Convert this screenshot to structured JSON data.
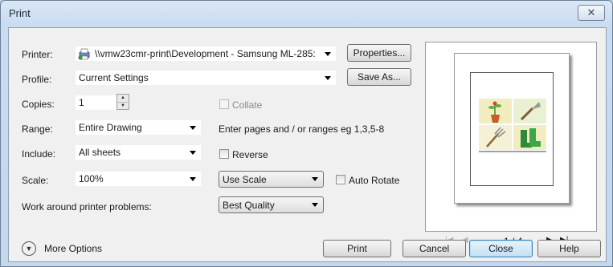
{
  "window": {
    "title": "Print",
    "close_label": "✕"
  },
  "printer": {
    "label": "Printer:",
    "value": "\\\\vmw23cmr-print\\Development - Samsung ML-285:",
    "properties_label": "Properties..."
  },
  "profile": {
    "label": "Profile:",
    "value": "Current Settings",
    "save_as_label": "Save As..."
  },
  "copies": {
    "label": "Copies:",
    "value": "1",
    "collate_label": "Collate"
  },
  "range": {
    "label": "Range:",
    "value": "Entire Drawing",
    "hint": "Enter pages and / or ranges eg 1,3,5-8"
  },
  "include": {
    "label": "Include:",
    "value": "All sheets",
    "reverse_label": "Reverse"
  },
  "scale": {
    "label": "Scale:",
    "value": "100%",
    "mode": "Use Scale",
    "auto_rotate_label": "Auto Rotate"
  },
  "workaround": {
    "label": "Work around printer problems:",
    "value": "Best Quality"
  },
  "preview": {
    "page_indicator": "1 / 4"
  },
  "more_options_label": "More Options",
  "buttons": {
    "print": "Print",
    "cancel": "Cancel",
    "close": "Close",
    "help": "Help"
  },
  "icons": {
    "printer": "printer-icon",
    "plant": "potted-plant-icon",
    "trowel": "trowel-icon",
    "rake": "hand-rake-icon",
    "boots": "wellington-boots-icon"
  }
}
